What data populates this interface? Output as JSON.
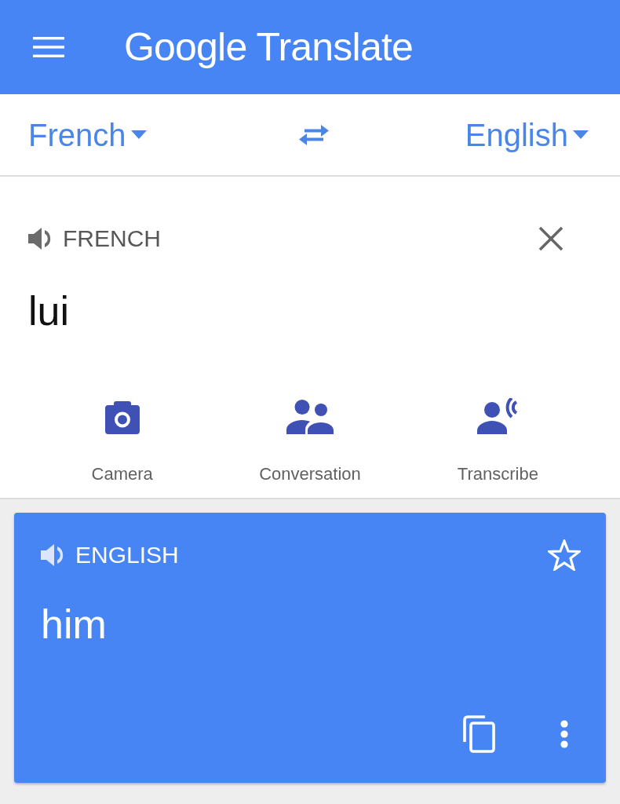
{
  "app_bar": {
    "title": "Google Translate"
  },
  "language_bar": {
    "source": "French",
    "target": "English"
  },
  "input": {
    "language_label": "FRENCH",
    "text": "lui"
  },
  "tools": [
    {
      "kind": "camera",
      "label": "Camera"
    },
    {
      "kind": "conversation",
      "label": "Conversation"
    },
    {
      "kind": "transcribe",
      "label": "Transcribe"
    }
  ],
  "output": {
    "language_label": "ENGLISH",
    "text": "him",
    "starred": false
  }
}
